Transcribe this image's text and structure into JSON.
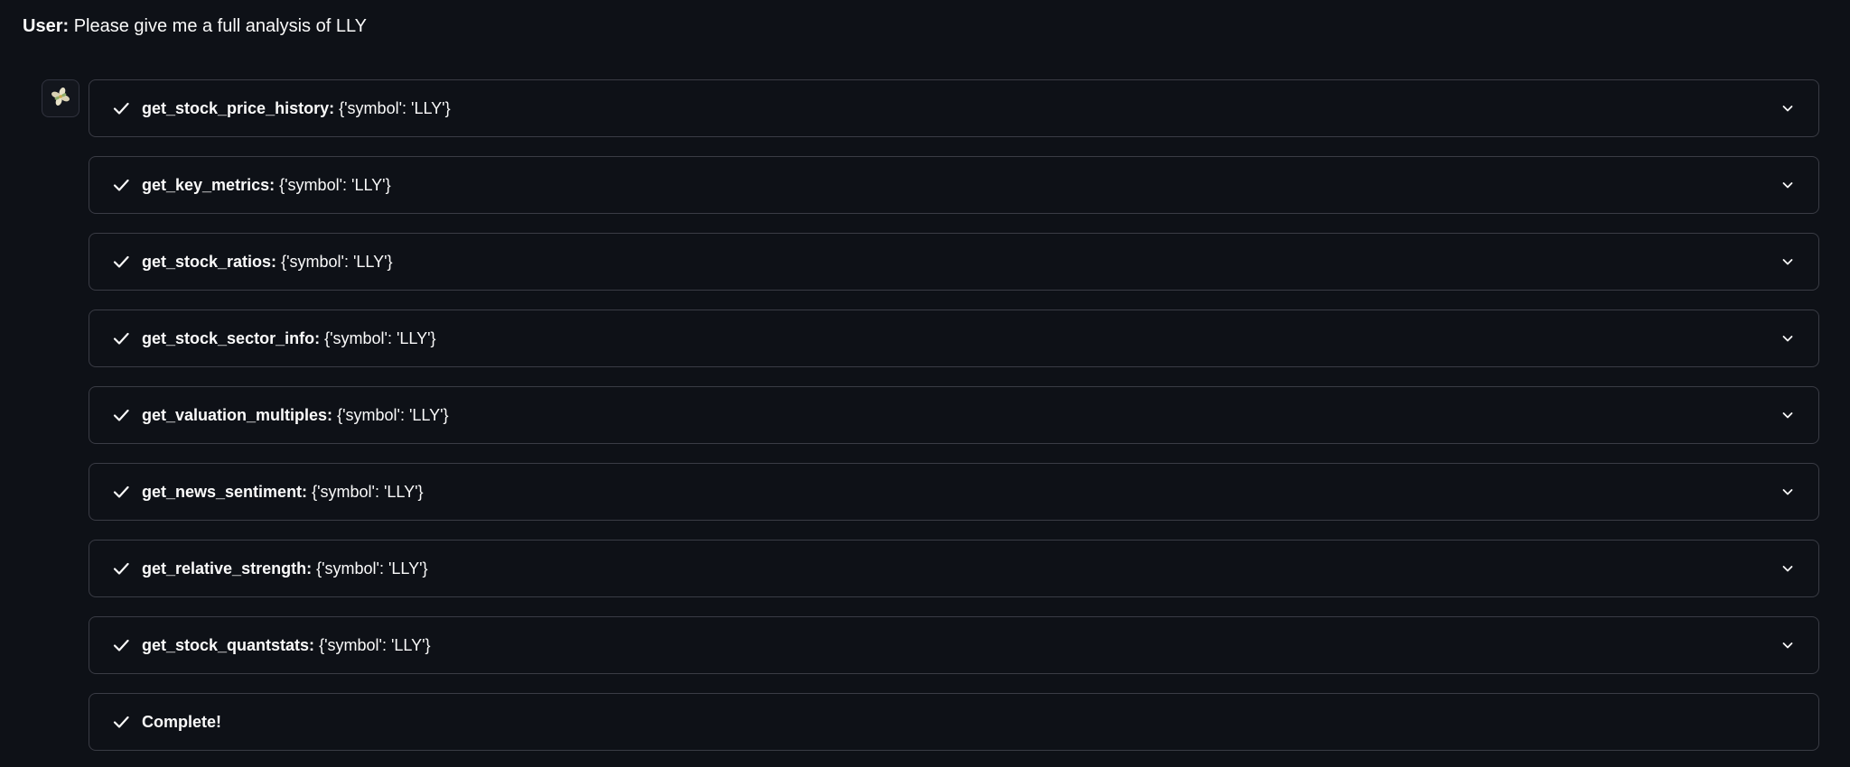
{
  "user_message": {
    "label": "User:",
    "text": "Please give me a full analysis of LLY"
  },
  "assistant": {
    "avatar_icon": "flower-icon"
  },
  "steps": [
    {
      "name": "get_stock_price_history:",
      "args": "{'symbol': 'LLY'}",
      "status_icon": "check-icon",
      "expandable": true
    },
    {
      "name": "get_key_metrics:",
      "args": "{'symbol': 'LLY'}",
      "status_icon": "check-icon",
      "expandable": true
    },
    {
      "name": "get_stock_ratios:",
      "args": "{'symbol': 'LLY'}",
      "status_icon": "check-icon",
      "expandable": true
    },
    {
      "name": "get_stock_sector_info:",
      "args": "{'symbol': 'LLY'}",
      "status_icon": "check-icon",
      "expandable": true
    },
    {
      "name": "get_valuation_multiples:",
      "args": "{'symbol': 'LLY'}",
      "status_icon": "check-icon",
      "expandable": true
    },
    {
      "name": "get_news_sentiment:",
      "args": "{'symbol': 'LLY'}",
      "status_icon": "check-icon",
      "expandable": true
    },
    {
      "name": "get_relative_strength:",
      "args": "{'symbol': 'LLY'}",
      "status_icon": "check-icon",
      "expandable": true
    },
    {
      "name": "get_stock_quantstats:",
      "args": "{'symbol': 'LLY'}",
      "status_icon": "check-icon",
      "expandable": true
    },
    {
      "name": "Complete!",
      "args": "",
      "status_icon": "check-icon",
      "expandable": false
    }
  ],
  "colors": {
    "background": "#0e1117",
    "border": "#3a3c45",
    "text": "#fafafa"
  }
}
